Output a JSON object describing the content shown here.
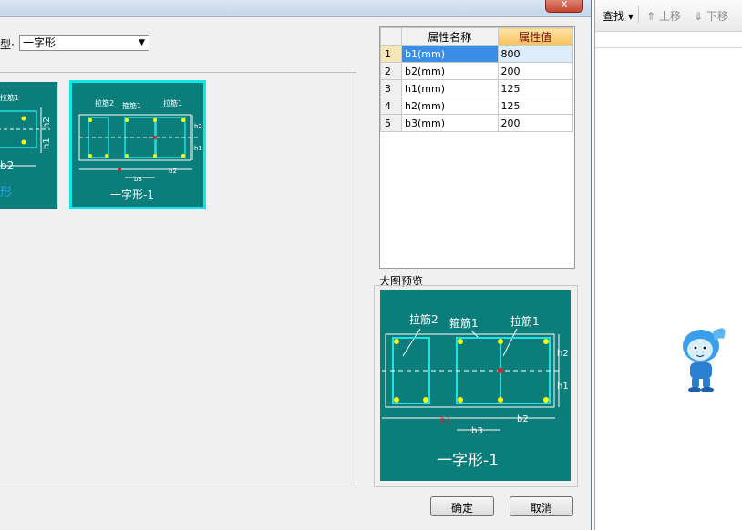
{
  "dialog": {
    "close_label": "x",
    "type_label": "型·",
    "type_value": "一字形",
    "thumbs": [
      {
        "top_label": "拉筋1",
        "bottom_label": "b2",
        "caption": "形",
        "dim1": "h2",
        "dim2": "h1"
      },
      {
        "label_a": "拉筋2",
        "label_b": "箍筋1",
        "label_c": "拉筋1",
        "dim_h2": "h2",
        "dim_h1": "h1",
        "dim_b3": "b3",
        "dim_b2": "b2",
        "caption": "一字形-1"
      }
    ],
    "table": {
      "headers": [
        "属性名称",
        "属性值"
      ],
      "rows": [
        {
          "n": "1",
          "name": "b1(mm)",
          "value": "800"
        },
        {
          "n": "2",
          "name": "b2(mm)",
          "value": "200"
        },
        {
          "n": "3",
          "name": "h1(mm)",
          "value": "125"
        },
        {
          "n": "4",
          "name": "h2(mm)",
          "value": "125"
        },
        {
          "n": "5",
          "name": "b3(mm)",
          "value": "200"
        }
      ]
    },
    "preview_label": "大图预览",
    "preview": {
      "label_a": "拉筋2",
      "label_b": "箍筋1",
      "label_c": "拉筋1",
      "dim_h2": "h2",
      "dim_h1": "h1",
      "dim_b1": "b1",
      "dim_b3": "b3",
      "dim_b2": "b2",
      "caption": "一字形-1"
    },
    "ok_label": "确定",
    "cancel_label": "取消"
  },
  "side": {
    "find_label": "查找 ▾",
    "up_label": "⇑ 上移",
    "down_label": "⇓ 下移"
  },
  "colors": {
    "teal": "#0b7d7b",
    "cyan": "#12e4e8",
    "yellow": "#ffff00"
  }
}
